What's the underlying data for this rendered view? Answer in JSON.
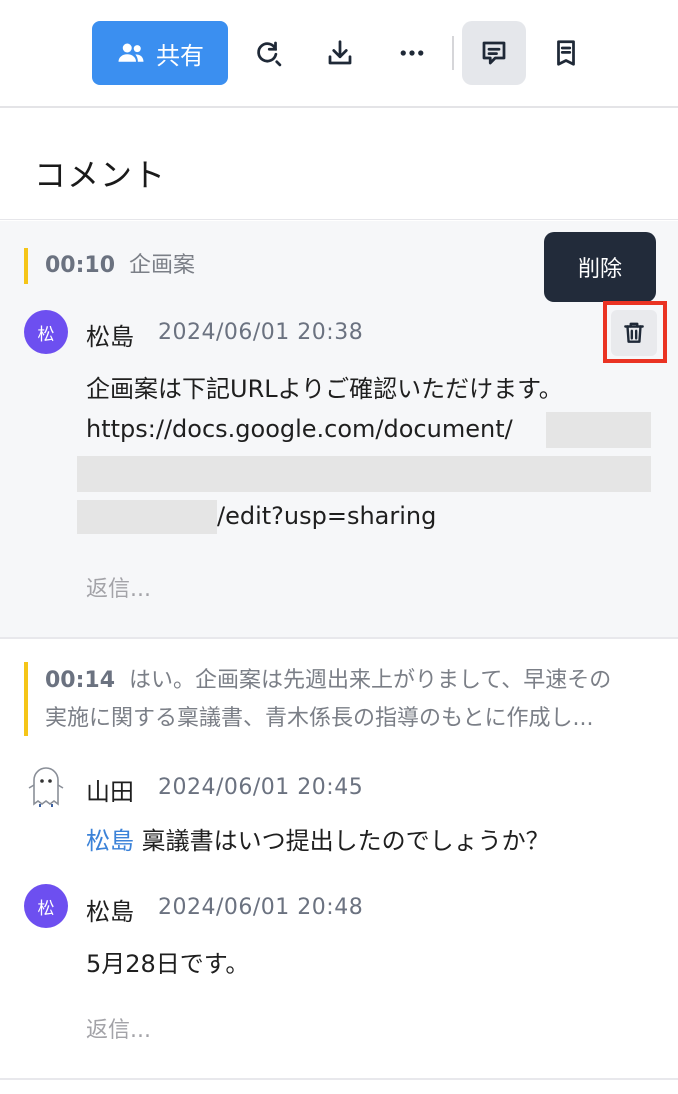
{
  "toolbar": {
    "share_label": "共有",
    "icons": [
      "people-icon",
      "search-refresh-icon",
      "download-icon",
      "more-icon",
      "comment-icon",
      "note-icon"
    ]
  },
  "comments_header": {
    "title": "コメント"
  },
  "tooltip": {
    "label": "削除"
  },
  "thread1": {
    "quote": {
      "time": "00:10",
      "text": "企画案"
    },
    "comment": {
      "avatar": "松",
      "author": "松島",
      "date": "2024/06/01 20:38",
      "lines": [
        "企画案は下記URLよりご確認いただけます。",
        "https://docs.google.com/document/",
        "/edit?usp=sharing"
      ]
    },
    "reply_placeholder": "返信..."
  },
  "thread2": {
    "quote": {
      "time": "00:14",
      "line1": "はい。企画案は先週出来上がりまして、早速その",
      "line2": "実施に関する稟議書、青木係長の指導のもとに作成し..."
    },
    "comments": [
      {
        "author": "山田",
        "date": "2024/06/01 20:45",
        "mention": "松島",
        "text": " 稟議書はいつ提出したのでしょうか？"
      },
      {
        "avatar": "松",
        "author": "松島",
        "date": "2024/06/01 20:48",
        "text": "5月28日です。"
      }
    ],
    "reply_placeholder": "返信..."
  },
  "colors": {
    "accent": "#3b8ff0",
    "avatar": "#6d4ff0",
    "quote_bar": "#f5c518",
    "highlight": "#ea3323",
    "mention": "#3b82d8"
  }
}
